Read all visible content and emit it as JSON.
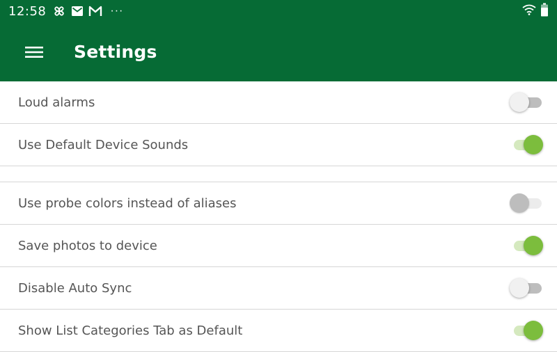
{
  "status_bar": {
    "time": "12:58",
    "dots": "···",
    "left_icons": [
      "pinwheel-icon",
      "email-icon",
      "gmail-icon"
    ],
    "right_icons": [
      "wifi-icon",
      "battery-icon"
    ]
  },
  "app_bar": {
    "title": "Settings",
    "menu_icon": "hamburger-menu-icon"
  },
  "colors": {
    "primary": "#066b35",
    "switch_on": "#7cbd3d",
    "switch_on_track": "#d5e9bf",
    "label_text": "#555555",
    "divider": "#d6d6d6"
  },
  "settings": {
    "items": [
      {
        "label": "Loud alarms",
        "state": "off"
      },
      {
        "label": "Use Default Device Sounds",
        "state": "on"
      },
      {
        "label": "Use probe colors instead of aliases",
        "state": "disabled-off"
      },
      {
        "label": "Save photos to device",
        "state": "on"
      },
      {
        "label": "Disable Auto Sync",
        "state": "off"
      },
      {
        "label": "Show List Categories Tab as Default",
        "state": "on"
      }
    ]
  }
}
